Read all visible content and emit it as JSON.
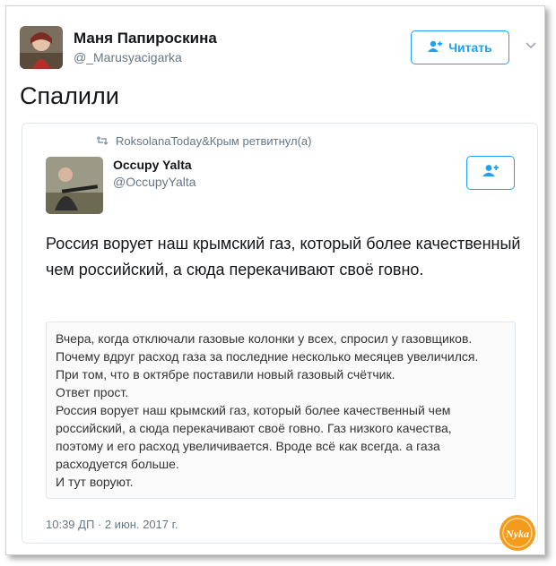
{
  "tweet": {
    "author_name": "Маня Папироскина",
    "author_handle": "@_Marusyacigarka",
    "follow_label": "Читать",
    "text": "Спалили"
  },
  "quote": {
    "retweet_label": "RoksolanaToday&Крым ретвитнул(а)",
    "author_name": "Occupy Yalta",
    "author_handle": "@OccupyYalta",
    "text": "Россия ворует наш крымский газ, который более качественный чем российский, а сюда перекачивают своё говно.",
    "image_lines": [
      "Вчера, когда отключали газовые колонки у всех, спросил у газовщиков.",
      "Почему вдруг расход газа за последние несколько месяцев увеличился.",
      "При том, что в октябре поставили новый газовый счётчик.",
      "Ответ прост.",
      "Россия ворует наш крымский газ, который более качественный чем",
      "российский, а сюда перекачивают своё говно. Газ низкого качества,",
      "поэтому и его расход увеличивается. Вроде всё как всегда. а газа",
      "расходуется больше.",
      "И тут воруют."
    ],
    "timestamp": "10:39 ДП · 2 июн. 2017 г."
  },
  "watermark": {
    "text": "Nyka",
    "color": "#f29b1d"
  },
  "colors": {
    "accent": "#1da1f2",
    "secondary_text": "#657786"
  }
}
